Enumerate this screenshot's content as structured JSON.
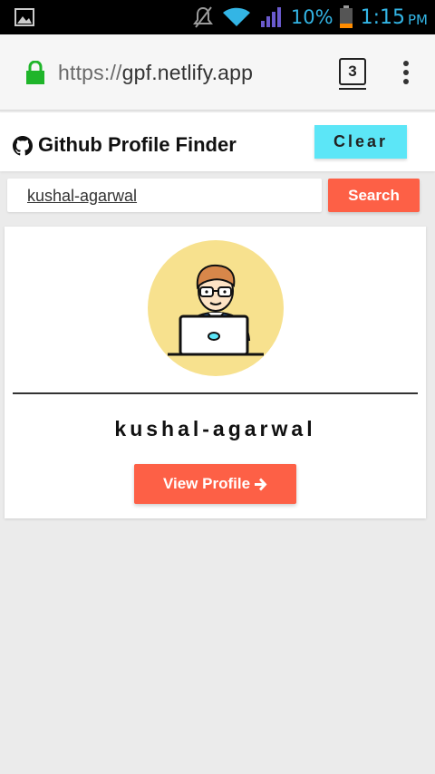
{
  "status_bar": {
    "battery_percent": "10%",
    "time": "1:15",
    "ampm": "PM",
    "icons": [
      "gallery-icon",
      "mute-icon",
      "wifi-icon",
      "signal-icon",
      "battery-icon"
    ],
    "accent_color": "#33b5e5"
  },
  "browser": {
    "url_scheme": "https://",
    "url_host": "gpf.netlify.app",
    "tab_count": "3",
    "lock_color": "#1fb52a"
  },
  "app": {
    "title": "Github Profile Finder",
    "clear_label": "Clear",
    "clear_color": "#5ce6f7"
  },
  "search": {
    "value": "kushal-agarwal",
    "button_label": "Search",
    "button_color": "#fd6046"
  },
  "profile": {
    "username": "kushal-agarwal",
    "view_label": "View Profile"
  }
}
